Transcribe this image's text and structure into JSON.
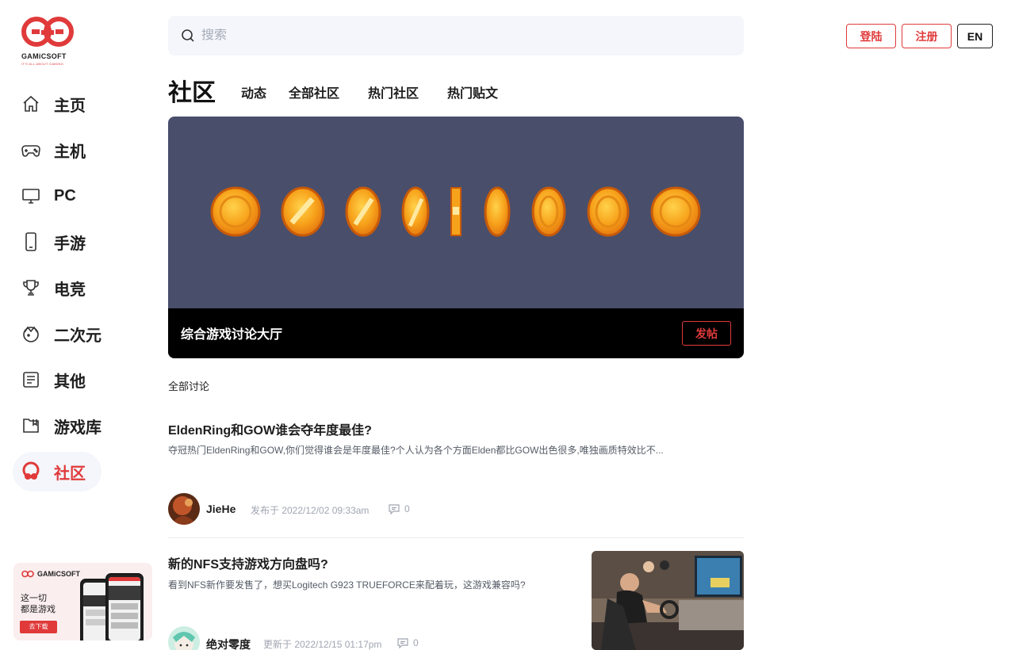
{
  "brand": {
    "name": "GAMiCSOFT",
    "tagline": "IT'S ALL ABOUT GAMING",
    "accent": "#e03a3a"
  },
  "sidebar": {
    "items": [
      {
        "label": "主页",
        "icon": "home-icon",
        "active": false
      },
      {
        "label": "主机",
        "icon": "gamepad-icon",
        "active": false
      },
      {
        "label": "PC",
        "icon": "monitor-icon",
        "active": false
      },
      {
        "label": "手游",
        "icon": "phone-icon",
        "active": false
      },
      {
        "label": "电竞",
        "icon": "trophy-icon",
        "active": false
      },
      {
        "label": "二次元",
        "icon": "anime-icon",
        "active": false
      },
      {
        "label": "其他",
        "icon": "list-icon",
        "active": false
      },
      {
        "label": "游戏库",
        "icon": "library-icon",
        "active": false
      },
      {
        "label": "社区",
        "icon": "community-icon",
        "active": true
      }
    ],
    "promo": {
      "brand": "GAMiCSOFT",
      "line1": "这一切",
      "line2": "都是游戏",
      "button": "去下载"
    }
  },
  "header": {
    "search": {
      "placeholder": "搜索",
      "value": ""
    },
    "login_label": "登陆",
    "register_label": "注册",
    "lang_label": "EN"
  },
  "page": {
    "title": "社区",
    "tabs": [
      "动态",
      "全部社区",
      "热门社区",
      "热门贴文"
    ]
  },
  "banner": {
    "title": "综合游戏讨论大厅",
    "post_button": "发帖",
    "bg_color": "#494e6b"
  },
  "section_label": "全部讨论",
  "posts": [
    {
      "title": "EldenRing和GOW谁会夺年度最佳?",
      "excerpt": "夺冠热门EldenRing和GOW,你们觉得谁会是年度最佳?个人认为各个方面Elden都比GOW出色很多,唯独画质特效比不...",
      "author": "JieHe",
      "meta": "发布于 2022/12/02 09:33am",
      "comments": "0"
    },
    {
      "title": "新的NFS支持游戏方向盘吗?",
      "excerpt": "看到NFS新作要发售了，想买Logitech G923 TRUEFORCE来配着玩，这游戏兼容吗?",
      "author": "绝对零度",
      "meta": "更新于 2022/12/15 01:17pm",
      "comments": "0"
    }
  ]
}
